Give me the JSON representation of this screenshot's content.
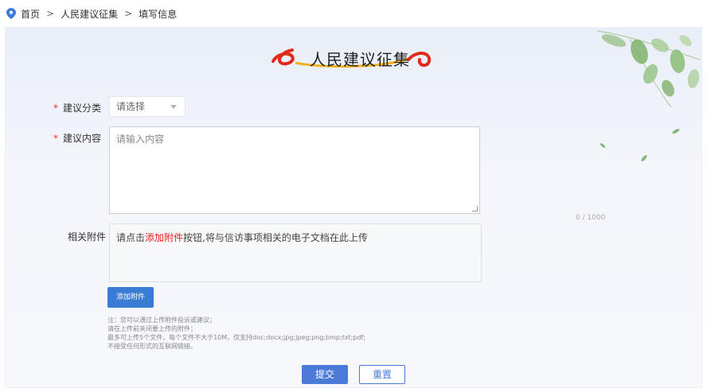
{
  "breadcrumb": {
    "home": "首页",
    "level2": "人民建议征集",
    "current": "填写信息",
    "separator": ">"
  },
  "header": {
    "title": "人民建议征集"
  },
  "form": {
    "category": {
      "label": "建议分类",
      "required_mark": "*",
      "placeholder": "请选择"
    },
    "content": {
      "label": "建议内容",
      "required_mark": "*",
      "placeholder": "请输入内容",
      "counter": "0 / 1000"
    },
    "attachment": {
      "label": "相关附件",
      "hint_prefix": "请点击",
      "hint_link": "添加附件",
      "hint_suffix": "按钮,将与信访事项相关的电子文档在此上传",
      "add_button": "添加附件"
    },
    "notes": [
      "注：您可以通过上传附件投诉或建议；",
      "请在上传前关闭要上传的附件；",
      "最多可上传5个文件，每个文件不大于10M，仅支持doc;docx;jpg;jpeg;png;bmp;txt;pdf;",
      "不接受任何形式的互联网链接。"
    ]
  },
  "actions": {
    "submit": "提交",
    "reset": "重置"
  },
  "colors": {
    "primary": "#4b7bd8",
    "required": "#e33333",
    "highlight": "#e62020"
  }
}
